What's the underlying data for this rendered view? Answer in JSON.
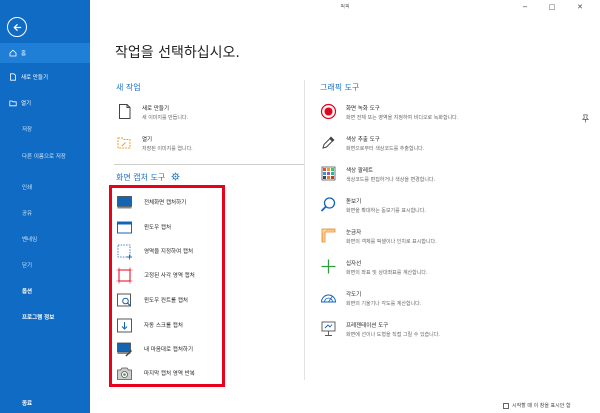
{
  "window": {
    "title": "픽픽",
    "minimize": "−",
    "maximize": "□",
    "close": "✕"
  },
  "sidebar": {
    "items": [
      {
        "label": "홈"
      },
      {
        "label": "새로 만들기"
      },
      {
        "label": "열기"
      },
      {
        "label": "저장"
      },
      {
        "label": "다른 이름으로 저장"
      },
      {
        "label": "인쇄"
      },
      {
        "label": "공유"
      },
      {
        "label": "벤네임"
      },
      {
        "label": "닫기"
      },
      {
        "label": "옵션"
      },
      {
        "label": "프로그램 정보"
      },
      {
        "label": "종료"
      }
    ]
  },
  "main": {
    "heading": "작업을 선택하십시오.",
    "new_task": {
      "title": "새 작업",
      "items": [
        {
          "title": "새로 만들기",
          "desc": "새 이미지를 만듭니다."
        },
        {
          "title": "열기",
          "desc": "저장된 이미지를 엽니다."
        }
      ]
    },
    "capture": {
      "title": "화면 캡처 도구",
      "items": [
        {
          "label": "전체화면 캡처하기"
        },
        {
          "label": "윈도우 캡처"
        },
        {
          "label": "영역을 지정하여 캡처"
        },
        {
          "label": "고정된 사각 영역 캡처"
        },
        {
          "label": "윈도우 컨트롤 캡처"
        },
        {
          "label": "자동 스크롤 캡처"
        },
        {
          "label": "내 마음대로 캡처하기"
        },
        {
          "label": "마지막 캡처 영역 반복"
        }
      ]
    },
    "graphic": {
      "title": "그래픽 도구",
      "items": [
        {
          "title": "화면 녹화 도구",
          "desc": "화면 전체 또는 영역을 지정하여 비디오로 녹화합니다."
        },
        {
          "title": "색상 추출 도구",
          "desc": "화면으로부터 색상코드를 추출합니다."
        },
        {
          "title": "색상 팔레트",
          "desc": "색상코드를 편집하거나 색상을 변경합니다."
        },
        {
          "title": "돋보기",
          "desc": "화면을 확대하는 돋보기를 표시합니다."
        },
        {
          "title": "눈금자",
          "desc": "화면의 객체를 픽셀이나 인치로 표시합니다."
        },
        {
          "title": "십자선",
          "desc": "화면의 좌표 및 상대좌표를 계산합니다."
        },
        {
          "title": "각도기",
          "desc": "화면의 기울기나 각도를 계산합니다."
        },
        {
          "title": "프레젠테이션 도구",
          "desc": "화면에 선이나 도형을 직접 그릴 수 있습니다."
        }
      ]
    }
  },
  "footer": {
    "startup_label": "시작할 때 이 창을 표시안 함"
  },
  "colors": {
    "sidebar": "#0f6bc4",
    "accent": "#1a73c9",
    "highlight_border": "#e8001c"
  }
}
